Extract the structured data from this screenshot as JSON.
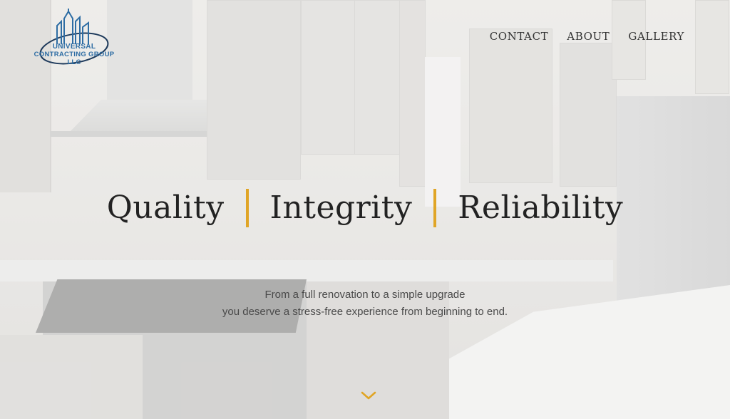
{
  "logo": {
    "line1": "UNIVERSAL",
    "line2": "CONTRACTING GROUP LLC",
    "icon": "building-skyline-icon",
    "color": "#2e6da4"
  },
  "nav": {
    "items": [
      {
        "label": "CONTACT"
      },
      {
        "label": "ABOUT"
      },
      {
        "label": "GALLERY"
      }
    ]
  },
  "hero": {
    "words": [
      "Quality",
      "Integrity",
      "Reliability"
    ],
    "accent_color": "#e0a526",
    "subtitle_line1": "From a full renovation to a simple upgrade",
    "subtitle_line2": "you deserve a stress-free experience from beginning to end.",
    "scroll_icon": "chevron-down-icon"
  }
}
